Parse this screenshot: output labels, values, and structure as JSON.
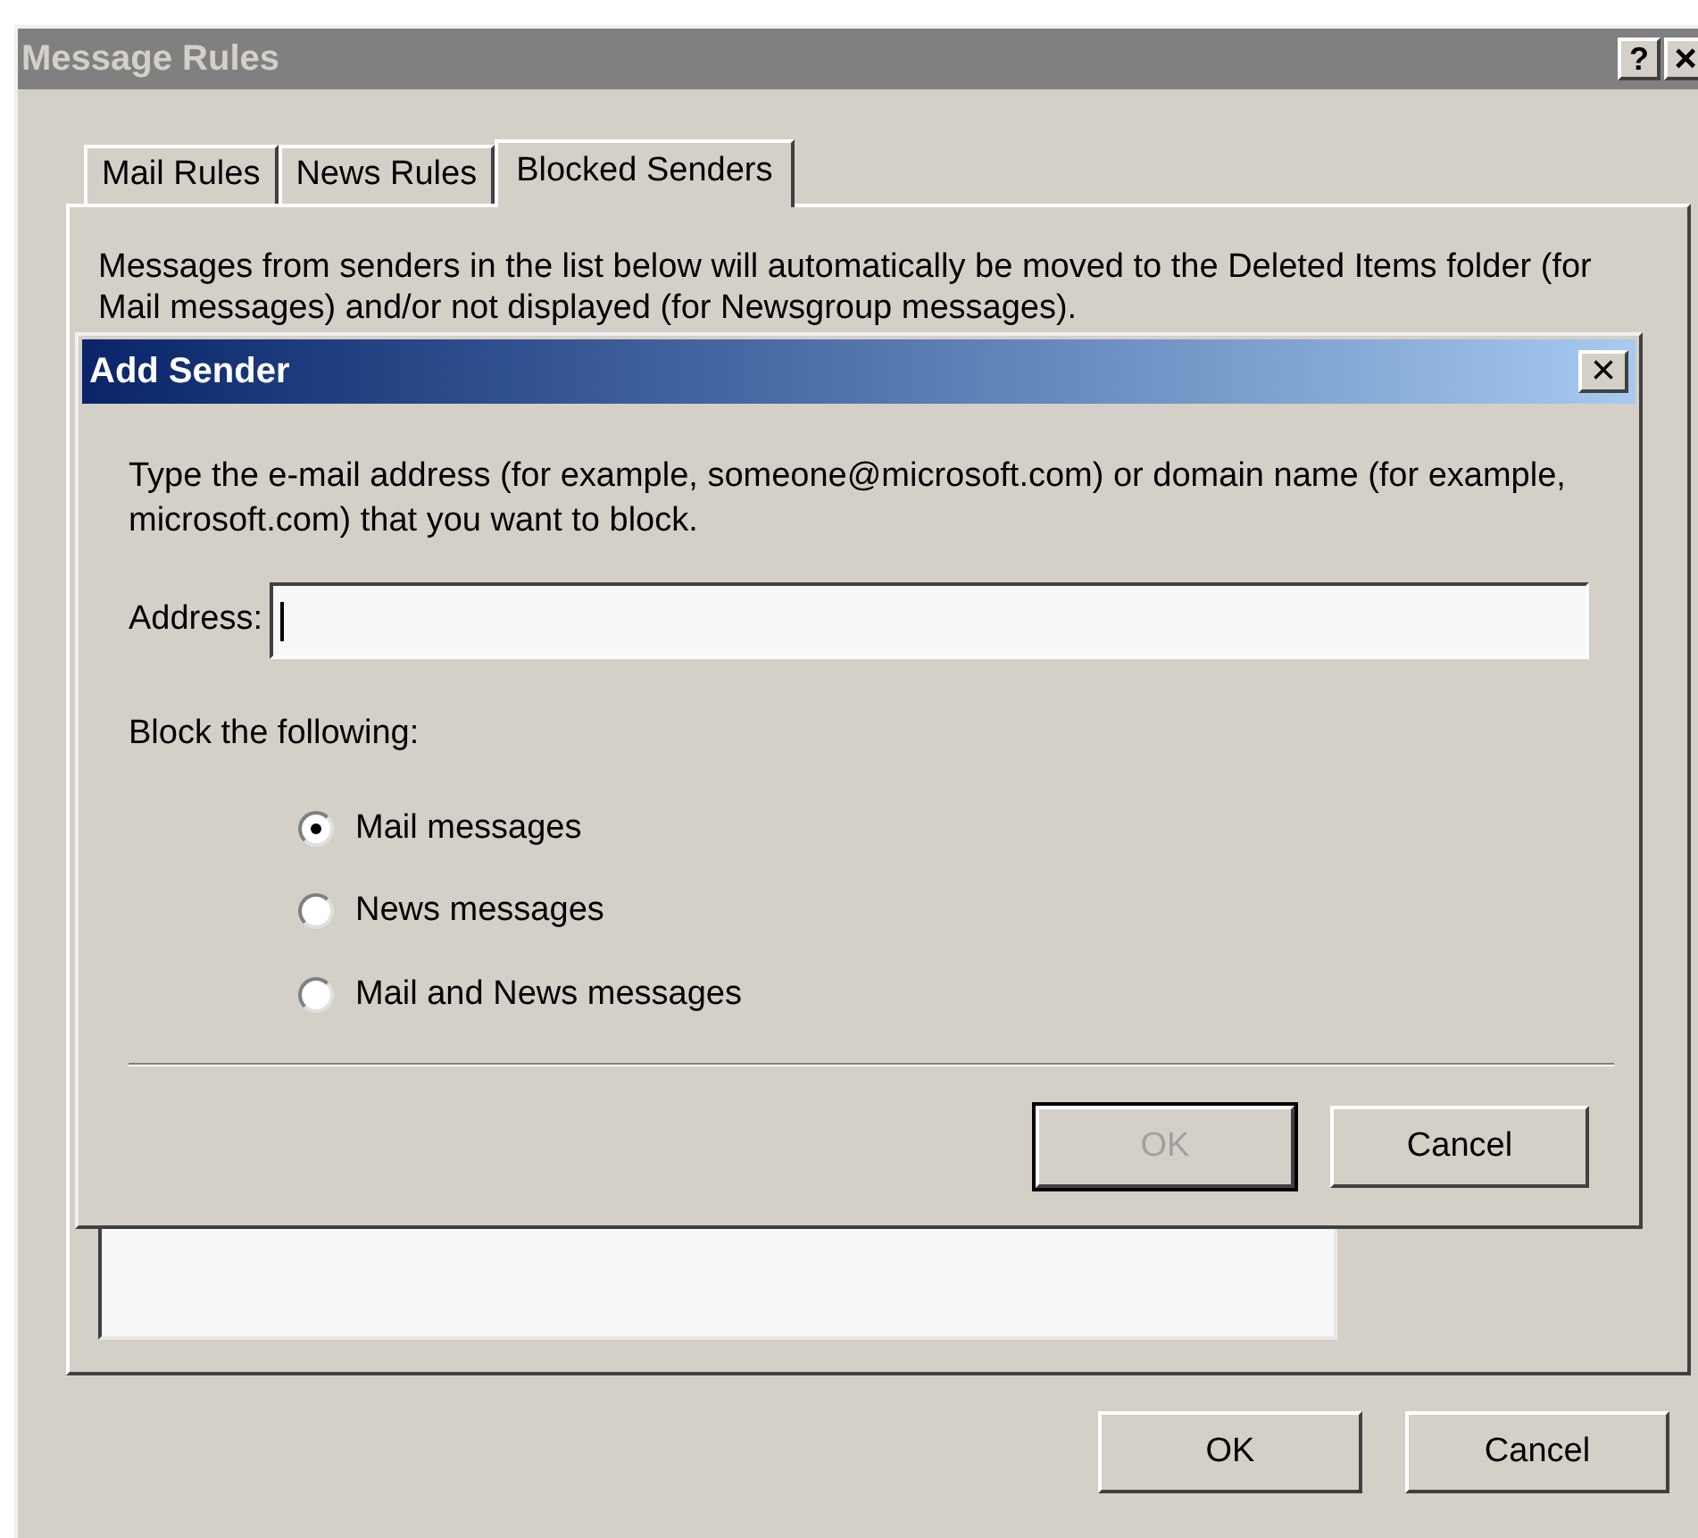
{
  "window": {
    "title": "Message Rules",
    "help": "?",
    "close": "×"
  },
  "tabs": [
    {
      "label": "Mail Rules",
      "selected": false
    },
    {
      "label": "News Rules",
      "selected": false
    },
    {
      "label": "Blocked Senders",
      "selected": true
    }
  ],
  "description": "Messages from senders in the list below will automatically be moved to the Deleted Items folder (for Mail messages) and/or not displayed (for Newsgroup messages).",
  "dialog": {
    "title": "Add Sender",
    "close": "×",
    "instructions": "Type the e-mail address (for example, someone@microsoft.com) or domain name (for example, microsoft.com) that you want to block.",
    "address_label": "Address:",
    "block_label": "Block the following:",
    "options": [
      {
        "label": "Mail messages",
        "selected": true
      },
      {
        "label": "News messages",
        "selected": false
      },
      {
        "label": "Mail and News messages",
        "selected": false
      }
    ],
    "buttons": [
      {
        "label": "OK",
        "disabled": true,
        "default": true
      },
      {
        "label": "Cancel",
        "disabled": false,
        "default": false
      }
    ]
  },
  "buttons": [
    {
      "label": "OK"
    },
    {
      "label": "Cancel"
    }
  ]
}
